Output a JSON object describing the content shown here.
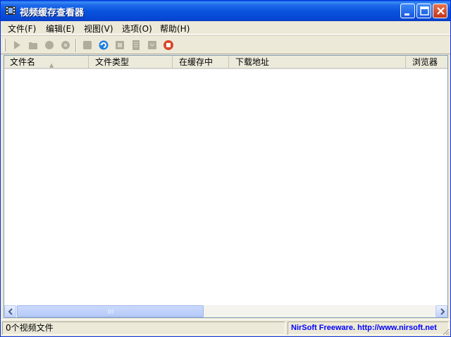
{
  "window": {
    "title": "视频缓存查看器",
    "app_icon": "film-icon",
    "controls": [
      "minimize-icon",
      "maximize-icon",
      "close-icon"
    ]
  },
  "menu": {
    "items": [
      {
        "label": "文件(F)"
      },
      {
        "label": "编辑(E)"
      },
      {
        "label": "视图(V)"
      },
      {
        "label": "选项(O)"
      },
      {
        "label": "帮助(H)"
      }
    ]
  },
  "toolbar": {
    "buttons": [
      {
        "icon": "play-icon",
        "enabled": false
      },
      {
        "icon": "folder-icon",
        "enabled": false
      },
      {
        "icon": "record-icon",
        "enabled": false
      },
      {
        "icon": "copy-circle-icon",
        "enabled": false
      },
      {
        "icon": "save-icon",
        "enabled": false
      },
      {
        "icon": "refresh-icon",
        "enabled": true
      },
      {
        "icon": "copy-icon",
        "enabled": false
      },
      {
        "icon": "properties-icon",
        "enabled": false
      },
      {
        "icon": "html-report-icon",
        "enabled": false
      },
      {
        "icon": "stop-icon",
        "enabled": true
      }
    ]
  },
  "list": {
    "columns": [
      {
        "label": "文件名",
        "sorted": true
      },
      {
        "label": "文件类型"
      },
      {
        "label": "在缓存中"
      },
      {
        "label": "下载地址"
      },
      {
        "label": "浏览器"
      }
    ],
    "rows": []
  },
  "status": {
    "count_text": "0个视频文件",
    "credit_text": "NirSoft Freeware.  http://www.nirsoft.net"
  },
  "colors": {
    "titlebar": "#0a54de",
    "credit": "#0000ff",
    "accent_refresh": "#1e7fe0",
    "accent_stop": "#d9472b"
  }
}
